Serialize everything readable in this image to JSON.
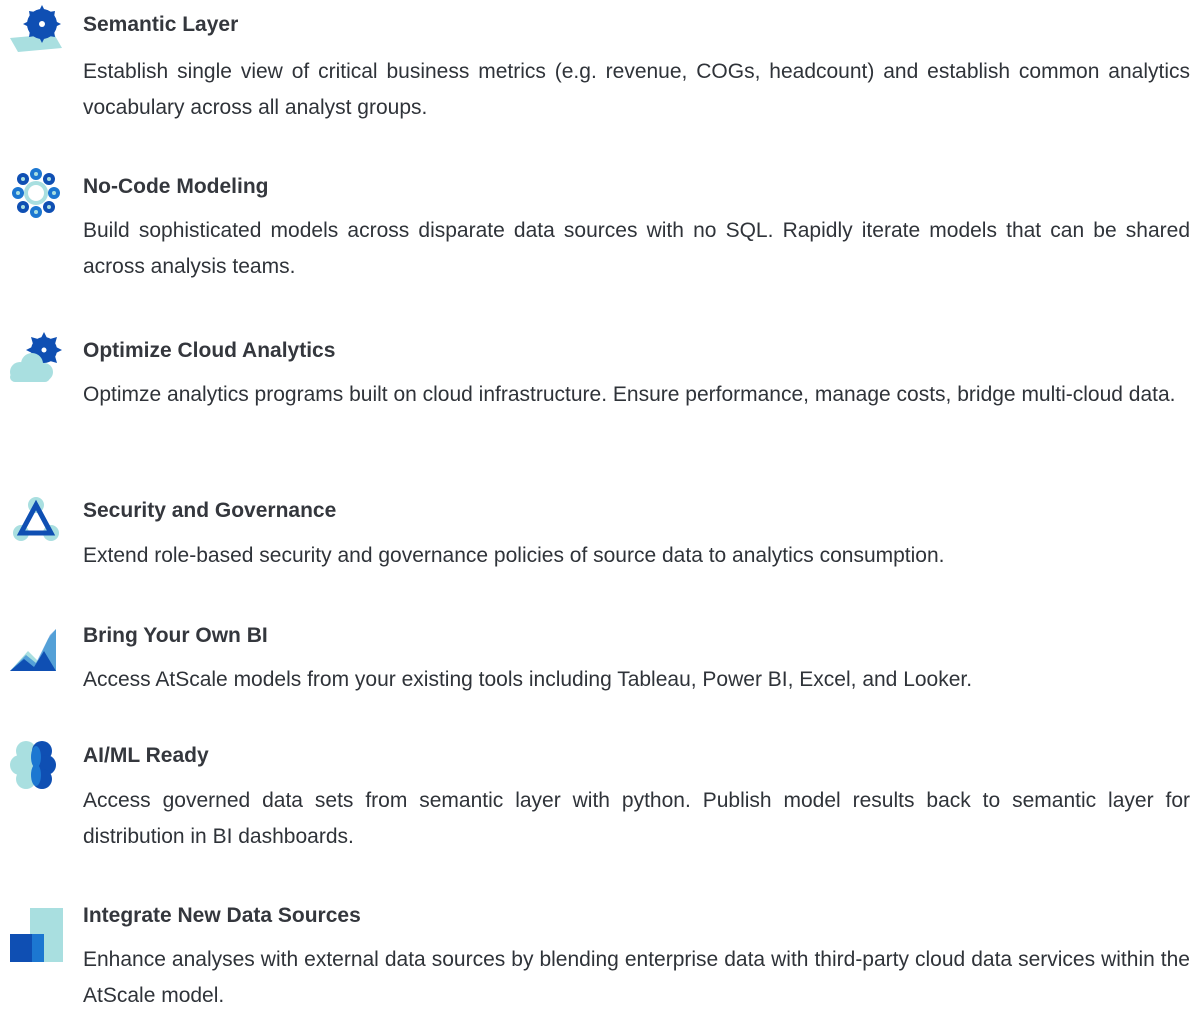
{
  "features": [
    {
      "icon": "sunburst-layer-icon",
      "title": "Semantic Layer",
      "description": "Establish single view of critical business metrics (e.g. revenue, COGs, headcount) and establish common analytics vocabulary across all analyst groups."
    },
    {
      "icon": "node-ring-icon",
      "title": "No-Code Modeling",
      "description": "Build sophisticated models across disparate data sources with no SQL. Rapidly iterate models that can be shared across analysis teams."
    },
    {
      "icon": "sun-cloud-icon",
      "title": "Optimize Cloud Analytics",
      "description": "Optimze analytics programs built on cloud infrastructure. Ensure performance, manage costs, bridge multi-cloud data."
    },
    {
      "icon": "triangle-shield-icon",
      "title": "Security and Governance",
      "description": "Extend role-based security and governance policies of source data to analytics consumption."
    },
    {
      "icon": "mountain-chart-icon",
      "title": "Bring Your Own BI",
      "description": "Access AtScale models from your existing tools including Tableau, Power BI, Excel, and Looker."
    },
    {
      "icon": "brain-cloud-icon",
      "title": "AI/ML Ready",
      "description": "Access governed data sets from semantic layer with python. Publish model results back to semantic layer for distribution in BI dashboards."
    },
    {
      "icon": "data-blocks-icon",
      "title": "Integrate New Data Sources",
      "description": "Enhance analyses with external data sources by blending enterprise data with third-party cloud data services within the AtScale model."
    }
  ],
  "colors": {
    "dark_blue": "#0f4fb3",
    "mid_blue": "#1c77d1",
    "light_teal": "#a9dfe0",
    "text": "#2f3339"
  }
}
